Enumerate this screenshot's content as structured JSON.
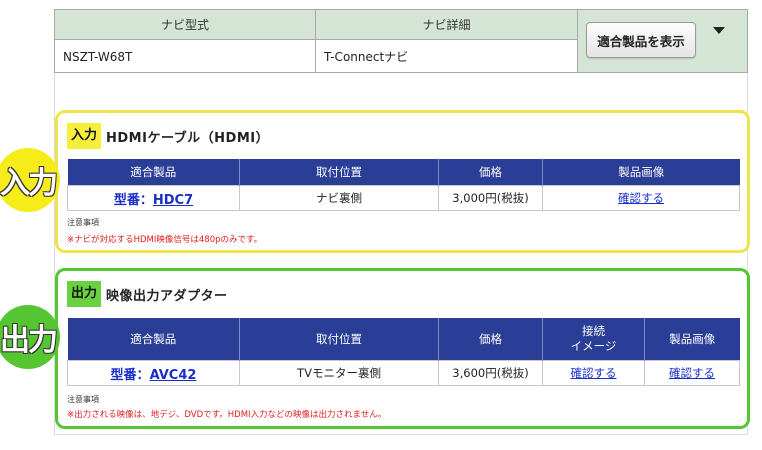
{
  "navi": {
    "col1_header": "ナビ型式",
    "col2_header": "ナビ詳細",
    "col1_value": "NSZT-W68T",
    "col2_value": "T-Connectナビ",
    "show_button": "適合製品を表示"
  },
  "badges": {
    "input": "入力",
    "output": "出力"
  },
  "input_section": {
    "tag": "入力",
    "name": "HDMIケーブル（HDMI）",
    "columns": [
      "適合製品",
      "取付位置",
      "価格",
      "製品画像"
    ],
    "row": {
      "model_prefix": "型番：",
      "model": "HDC7",
      "position": "ナビ裏側",
      "price": "3,000円(税抜)",
      "image_link": "確認する"
    },
    "note_label": "注意事項",
    "note": "※ナビが対応するHDMI映像信号は480pのみです。"
  },
  "output_section": {
    "tag": "出力",
    "name": "映像出力アダプター",
    "columns": [
      "適合製品",
      "取付位置",
      "価格",
      "接続\nイメージ",
      "製品画像"
    ],
    "col4_line1": "接続",
    "col4_line2": "イメージ",
    "row": {
      "model_prefix": "型番：",
      "model": "AVC42",
      "position": "TVモニター裏側",
      "price": "3,600円(税抜)",
      "connection_link": "確認する",
      "image_link": "確認する"
    },
    "note_label": "注意事項",
    "note": "※出力される映像は、地デジ、DVDです。HDMI入力などの映像は出力されません。"
  },
  "colors": {
    "input_accent": "#f0e44a",
    "output_accent": "#56c532",
    "table_header": "#2b3e97",
    "link": "#1a2ec9",
    "note_red": "#e31b1b",
    "navi_header_bg": "#d5e5d5"
  },
  "icons": {
    "dropdown": "chevron-down-icon"
  }
}
